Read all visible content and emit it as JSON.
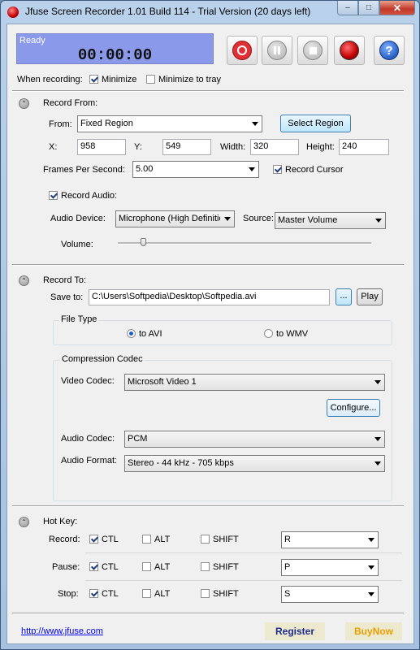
{
  "window": {
    "title": "Jfuse Screen Recorder 1.01 Build 114 - Trial Version (20 days left)",
    "minimize_glyph": "–",
    "maximize_glyph": "□",
    "close_glyph": "✕"
  },
  "status": {
    "text": "Ready",
    "time": "00:00:00"
  },
  "toolbar": {
    "buttons": [
      {
        "name": "record",
        "icon": "record-icon"
      },
      {
        "name": "pause",
        "icon": "pause-icon"
      },
      {
        "name": "stop",
        "icon": "stop-icon"
      },
      {
        "name": "stop-recording",
        "icon": "red-dot-icon"
      },
      {
        "name": "help",
        "icon": "help-icon",
        "glyph": "?"
      }
    ]
  },
  "when_recording": {
    "label": "When recording:",
    "minimize": {
      "label": "Minimize",
      "checked": true
    },
    "minimize_tray": {
      "label": "Minimize to tray",
      "checked": false
    }
  },
  "record_from": {
    "heading": "Record From:",
    "from_label": "From:",
    "from_value": "Fixed Region",
    "select_region_button": "Select Region",
    "x_label": "X:",
    "x_value": "958",
    "y_label": "Y:",
    "y_value": "549",
    "width_label": "Width:",
    "width_value": "320",
    "height_label": "Height:",
    "height_value": "240",
    "fps_label": "Frames Per Second:",
    "fps_value": "5.00",
    "record_cursor": {
      "label": "Record Cursor",
      "checked": true
    },
    "record_audio": {
      "label": "Record Audio:",
      "checked": true
    },
    "audio_device_label": "Audio Device:",
    "audio_device_value": "Microphone (High Definitio",
    "source_label": "Source:",
    "source_value": "Master Volume",
    "volume_label": "Volume:",
    "volume_level": 0.1
  },
  "record_to": {
    "heading": "Record To:",
    "save_to_label": "Save to:",
    "save_to_value": "C:\\Users\\Softpedia\\Desktop\\Softpedia.avi",
    "browse_button": "...",
    "play_button": "Play",
    "file_type_title": "File Type",
    "to_avi": {
      "label": "to AVI",
      "selected": true
    },
    "to_wmv": {
      "label": "to WMV",
      "selected": false
    },
    "codec_title": "Compression Codec",
    "video_codec_label": "Video Codec:",
    "video_codec_value": "Microsoft Video 1",
    "configure_button": "Configure...",
    "audio_codec_label": "Audio Codec:",
    "audio_codec_value": "PCM",
    "audio_format_label": "Audio Format:",
    "audio_format_value": "Stereo - 44 kHz - 705 kbps"
  },
  "hotkey": {
    "heading": "Hot Key:",
    "rows": [
      {
        "label": "Record:",
        "ctl": {
          "label": "CTL",
          "checked": true
        },
        "alt": {
          "label": "ALT",
          "checked": false
        },
        "shift": {
          "label": "SHIFT",
          "checked": false
        },
        "key": "R"
      },
      {
        "label": "Pause:",
        "ctl": {
          "label": "CTL",
          "checked": true
        },
        "alt": {
          "label": "ALT",
          "checked": false
        },
        "shift": {
          "label": "SHIFT",
          "checked": false
        },
        "key": "P"
      },
      {
        "label": "Stop:",
        "ctl": {
          "label": "CTL",
          "checked": true
        },
        "alt": {
          "label": "ALT",
          "checked": false
        },
        "shift": {
          "label": "SHIFT",
          "checked": false
        },
        "key": "S"
      }
    ]
  },
  "footer": {
    "link": "http://www.jfuse.com",
    "register": "Register",
    "buynow": "BuyNow"
  },
  "colors": {
    "status_bg": "#8a99ea",
    "record_red": "#d9232a",
    "help_blue": "#2d64c8",
    "buynow_text": "#f0a000"
  }
}
